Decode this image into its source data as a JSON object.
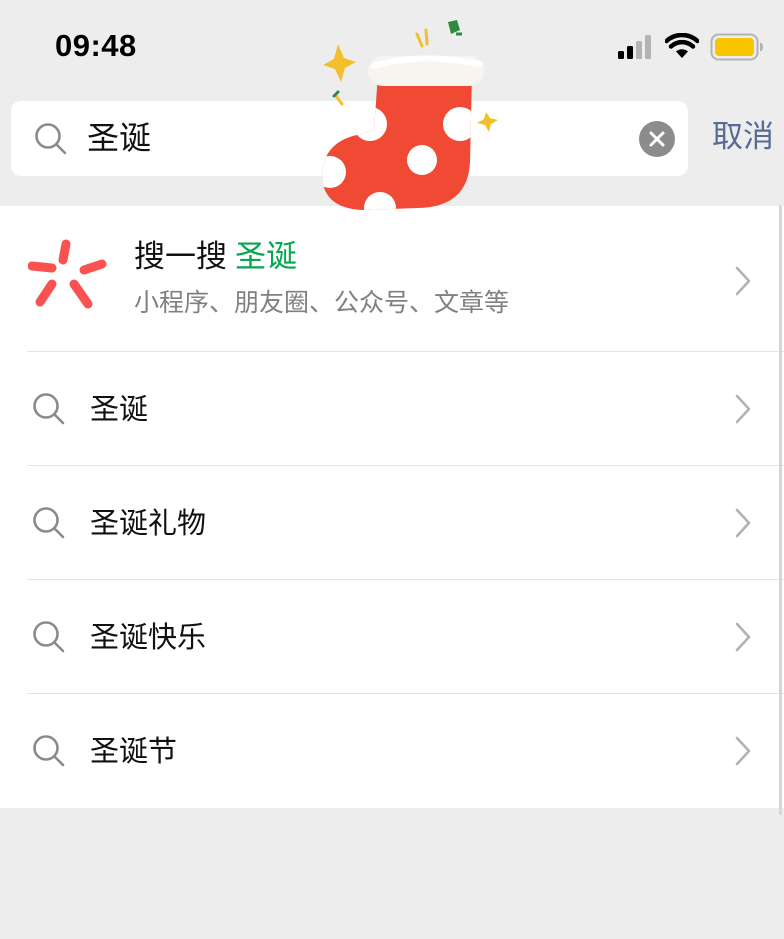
{
  "status_bar": {
    "time": "09:48",
    "signal_icon": "cellular-signal-icon",
    "wifi_icon": "wifi-icon",
    "battery_icon": "battery-icon"
  },
  "search": {
    "value": "圣诞",
    "icon": "search-icon",
    "clear_icon": "clear-icon",
    "cancel_label": "取消"
  },
  "sticker": {
    "icon": "christmas-stocking-icon"
  },
  "results": {
    "souyisou": {
      "prefix": "搜一搜",
      "keyword": "圣诞",
      "subtitle": "小程序、朋友圈、公众号、文章等",
      "icon": "souyisou-logo-icon"
    },
    "suggestions": [
      {
        "label": "圣诞"
      },
      {
        "label": "圣诞礼物"
      },
      {
        "label": "圣诞快乐"
      },
      {
        "label": "圣诞节"
      }
    ]
  },
  "colors": {
    "background": "#ededed",
    "keyword_green": "#07a650",
    "cancel_blue": "#576b95",
    "logo_red": "#fa5151",
    "battery_yellow": "#f7c600"
  }
}
